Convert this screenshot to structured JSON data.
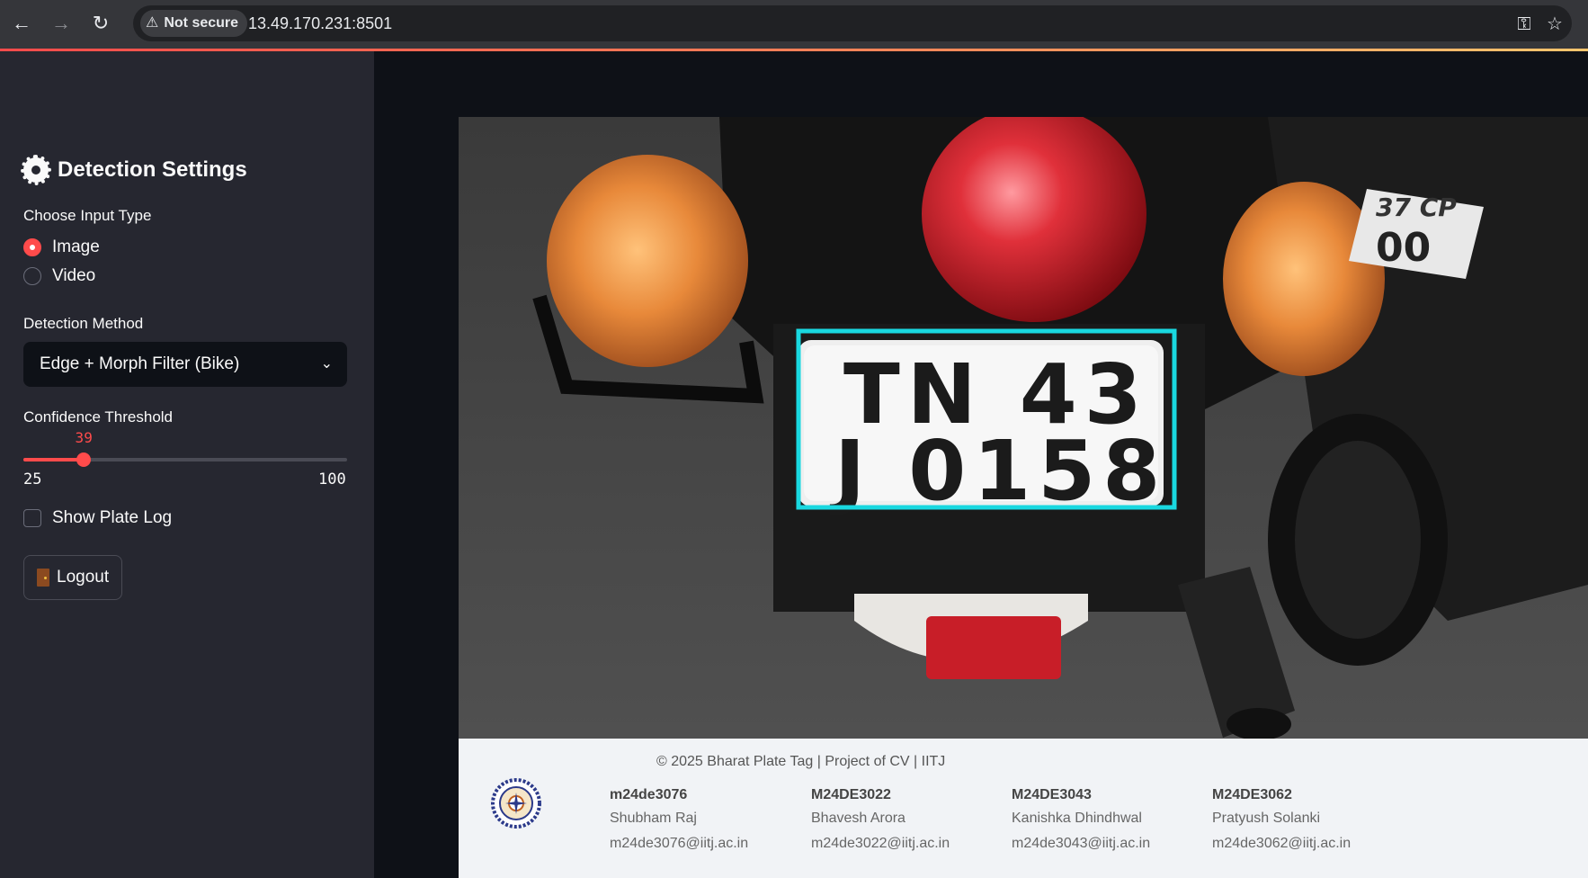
{
  "browser": {
    "security_label": "Not secure",
    "url": "13.49.170.231:8501",
    "icons": [
      "back-arrow-icon",
      "forward-arrow-icon",
      "reload-icon",
      "warning-triangle-icon",
      "key-icon",
      "star-icon"
    ]
  },
  "sidebar": {
    "title": "Detection Settings",
    "input_type_label": "Choose Input Type",
    "input_options": [
      "Image",
      "Video"
    ],
    "input_selected": "Image",
    "method_label": "Detection Method",
    "method_value": "Edge + Morph Filter (Bike)",
    "confidence_label": "Confidence Threshold",
    "confidence_value": "39",
    "confidence_min": "25",
    "confidence_max": "100",
    "plate_log_label": "Show Plate Log",
    "plate_log_checked": false,
    "logout_label": "Logout"
  },
  "main": {
    "plate_line1": "TN 43",
    "plate_line2": "J 0158"
  },
  "footer": {
    "copyright": "© 2025 Bharat Plate Tag | Project of CV | IITJ",
    "members": [
      {
        "id": "m24de3076",
        "name": "Shubham Raj",
        "email": "m24de3076@iitj.ac.in"
      },
      {
        "id": "M24DE3022",
        "name": "Bhavesh Arora",
        "email": "m24de3022@iitj.ac.in"
      },
      {
        "id": "M24DE3043",
        "name": "Kanishka Dhindhwal",
        "email": "m24de3043@iitj.ac.in"
      },
      {
        "id": "M24DE3062",
        "name": "Pratyush Solanki",
        "email": "m24de3062@iitj.ac.in"
      }
    ]
  },
  "colors": {
    "accent": "#ff4b4b",
    "sidebar_bg": "#262730",
    "app_bg": "#0e1117",
    "detection_box": "#19d8e0"
  }
}
